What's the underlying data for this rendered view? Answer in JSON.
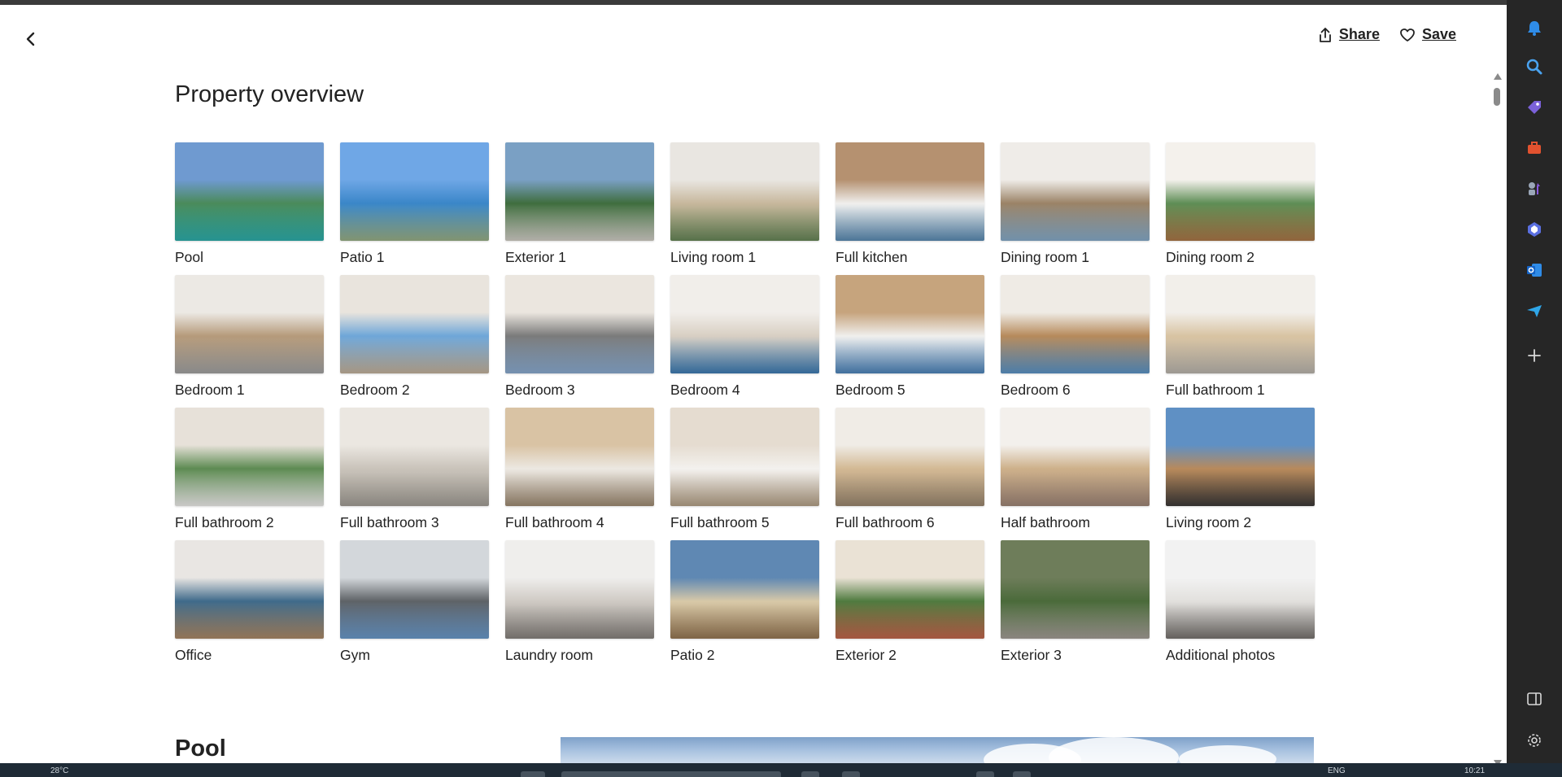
{
  "header": {
    "share_label": "Share",
    "save_label": "Save",
    "back_icon": "chevron-left-icon",
    "share_icon": "share-icon",
    "save_icon": "heart-icon"
  },
  "overview": {
    "title": "Property overview",
    "items": [
      {
        "label": "Pool",
        "colors": [
          "#6f9ad0",
          "#4a8a5a",
          "#2fb3b0"
        ]
      },
      {
        "label": "Patio 1",
        "colors": [
          "#6fa7e6",
          "#3a86c8",
          "#9db48a"
        ]
      },
      {
        "label": "Exterior 1",
        "colors": [
          "#7aa0c4",
          "#3f6d3e",
          "#d7d4cc"
        ]
      },
      {
        "label": "Living room 1",
        "colors": [
          "#e9e6e1",
          "#c7b79c",
          "#6a8a5a"
        ]
      },
      {
        "label": "Full kitchen",
        "colors": [
          "#b59170",
          "#f0efed",
          "#5d8fb8"
        ]
      },
      {
        "label": "Dining room 1",
        "colors": [
          "#efece8",
          "#9a8266",
          "#8ab0cf"
        ]
      },
      {
        "label": "Dining room 2",
        "colors": [
          "#f4f1ec",
          "#5e8d55",
          "#b07b4a"
        ]
      },
      {
        "label": "Bedroom 1",
        "colors": [
          "#ece9e4",
          "#b59a7a",
          "#a7a7a7"
        ]
      },
      {
        "label": "Bedroom 2",
        "colors": [
          "#e9e4dd",
          "#6ea6d8",
          "#c9b7a0"
        ]
      },
      {
        "label": "Bedroom 3",
        "colors": [
          "#ebe6df",
          "#7a7a7a",
          "#8eb0d6"
        ]
      },
      {
        "label": "Bedroom 4",
        "colors": [
          "#f1eeea",
          "#d8cfc3",
          "#3f7fb8"
        ]
      },
      {
        "label": "Bedroom 5",
        "colors": [
          "#c6a47d",
          "#f0efed",
          "#4f88c0"
        ]
      },
      {
        "label": "Bedroom 6",
        "colors": [
          "#efebe5",
          "#b68a5b",
          "#5e98cc"
        ]
      },
      {
        "label": "Full bathroom 1",
        "colors": [
          "#f2efea",
          "#d8c3a2",
          "#bfbab2"
        ]
      },
      {
        "label": "Full bathroom 2",
        "colors": [
          "#e7e1d9",
          "#5d8a52",
          "#f4f3f1"
        ]
      },
      {
        "label": "Full bathroom 3",
        "colors": [
          "#ebe7e1",
          "#c9c3ba",
          "#a7a29a"
        ]
      },
      {
        "label": "Full bathroom 4",
        "colors": [
          "#d9c3a4",
          "#ece8e2",
          "#a38f76"
        ]
      },
      {
        "label": "Full bathroom 5",
        "colors": [
          "#e5dcd0",
          "#f3f1ee",
          "#b9a58b"
        ]
      },
      {
        "label": "Full bathroom 6",
        "colors": [
          "#f0ece6",
          "#d3b994",
          "#9f8b72"
        ]
      },
      {
        "label": "Half bathroom",
        "colors": [
          "#f3f0ec",
          "#cdb08a",
          "#a3897a"
        ]
      },
      {
        "label": "Living room 2",
        "colors": [
          "#5f90c4",
          "#b88a5c",
          "#3e3b3a"
        ]
      },
      {
        "label": "Office",
        "colors": [
          "#e9e6e3",
          "#3f6a8a",
          "#b08d6a"
        ]
      },
      {
        "label": "Gym",
        "colors": [
          "#d3d7db",
          "#5e6266",
          "#6e9ed0"
        ]
      },
      {
        "label": "Laundry room",
        "colors": [
          "#efeeec",
          "#cfcac4",
          "#8a8580"
        ]
      },
      {
        "label": "Patio 2",
        "colors": [
          "#5f88b3",
          "#d8c9a8",
          "#9a7a55"
        ]
      },
      {
        "label": "Exterior 2",
        "colors": [
          "#eae2d5",
          "#4f7a3f",
          "#c8694f"
        ]
      },
      {
        "label": "Exterior 3",
        "colors": [
          "#6e7d5a",
          "#4a6a3a",
          "#a8a29a"
        ]
      },
      {
        "label": "Additional photos",
        "colors": [
          "#f2f2f2",
          "#e2e0dd",
          "#7a7672"
        ]
      }
    ]
  },
  "section": {
    "title": "Pool"
  },
  "side_rail": {
    "icons": [
      "bell-icon",
      "search-icon",
      "tag-icon",
      "toolbox-icon",
      "chess-icon",
      "copilot-icon",
      "outlook-icon",
      "send-icon",
      "add-icon",
      "split-view-icon",
      "settings-icon"
    ]
  },
  "taskbar": {
    "weather": "28°C",
    "language": "ENG",
    "time": "10:21"
  }
}
